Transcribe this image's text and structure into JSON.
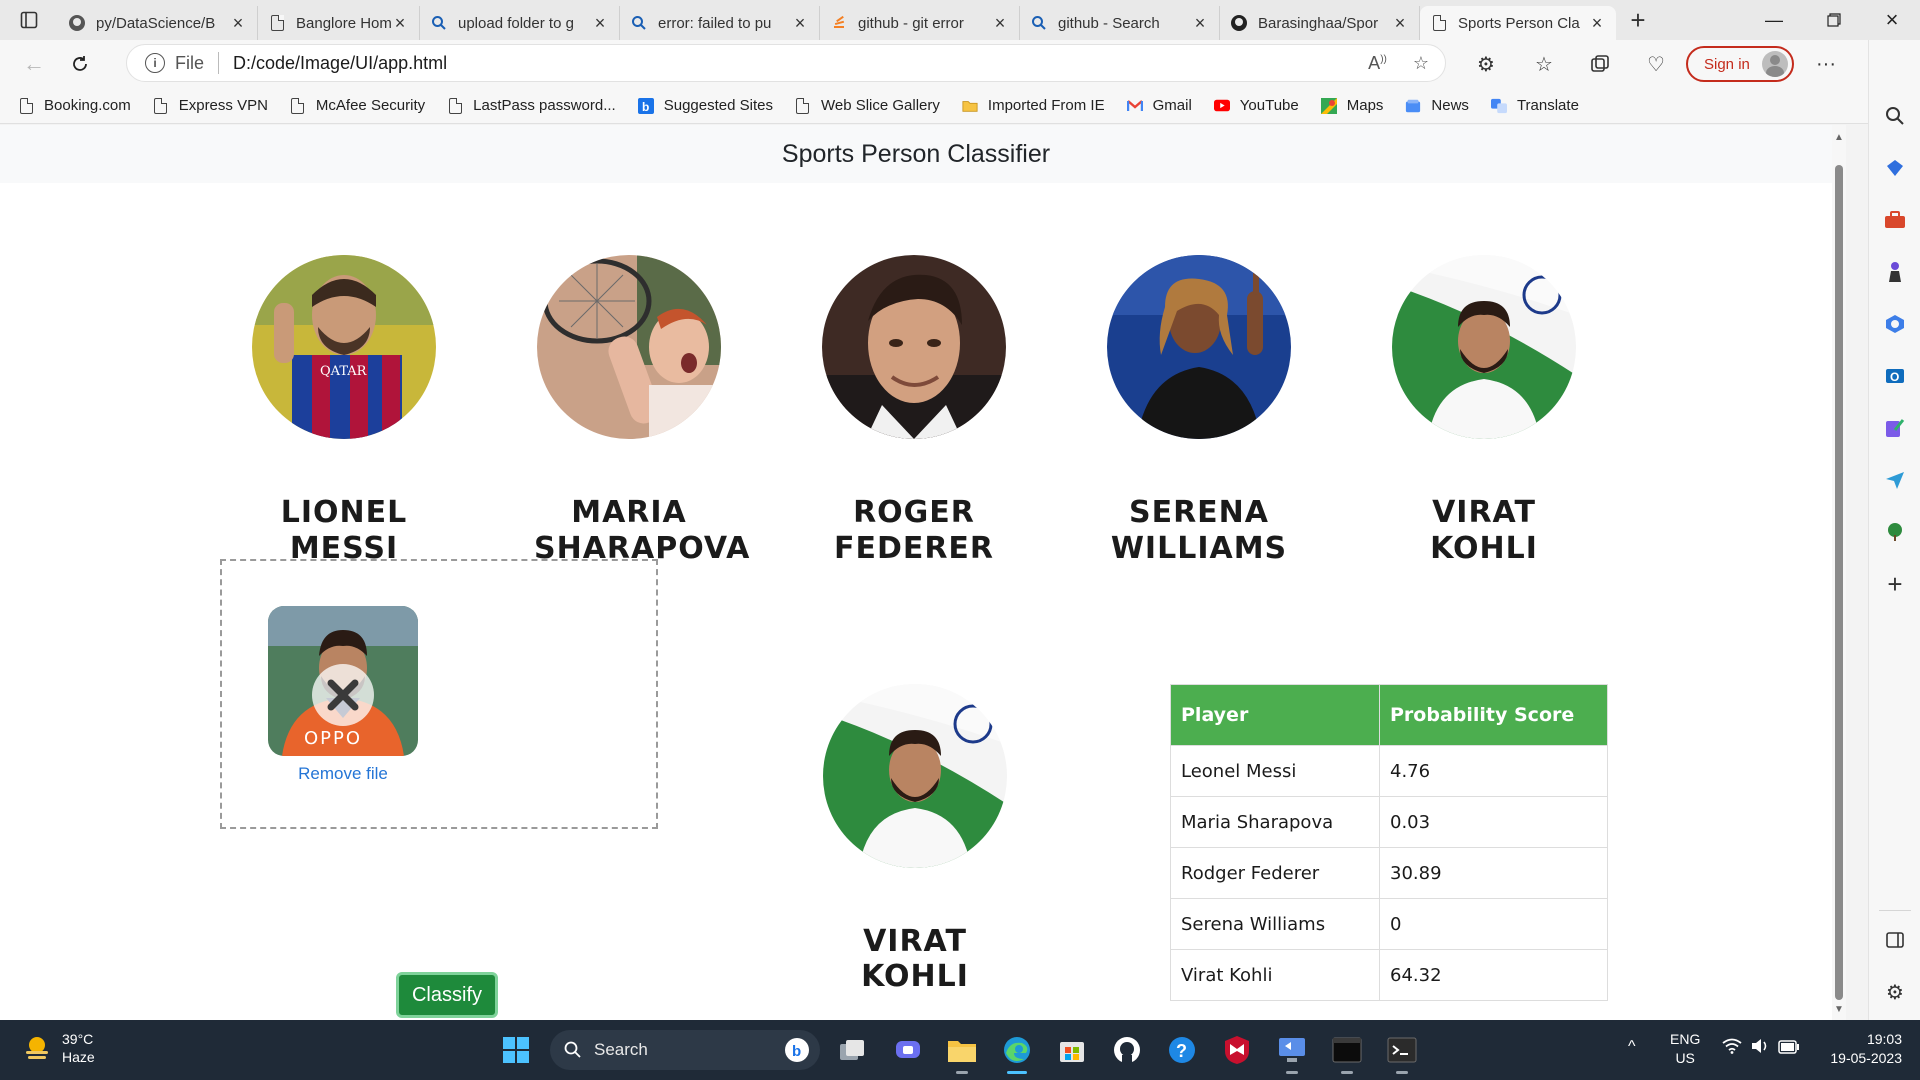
{
  "browser": {
    "tabs": [
      {
        "title": "py/DataScience/B",
        "icon": "github-icon"
      },
      {
        "title": "Banglore Home P",
        "icon": "page-icon"
      },
      {
        "title": "upload folder to g",
        "icon": "search-icon"
      },
      {
        "title": "error: failed to pu",
        "icon": "search-icon"
      },
      {
        "title": "github - git error",
        "icon": "stackoverflow-icon"
      },
      {
        "title": "github - Search",
        "icon": "search-icon"
      },
      {
        "title": "Barasinghaa/Spor",
        "icon": "github-icon"
      },
      {
        "title": "Sports Person Cla",
        "icon": "page-icon",
        "active": true
      }
    ],
    "address": {
      "scheme_label": "File",
      "url": "D:/code/Image/UI/app.html"
    },
    "sign_in_label": "Sign in",
    "bookmarks": [
      {
        "label": "Booking.com"
      },
      {
        "label": "Express VPN"
      },
      {
        "label": "McAfee Security"
      },
      {
        "label": "LastPass password..."
      },
      {
        "label": "Suggested Sites"
      },
      {
        "label": "Web Slice Gallery"
      },
      {
        "label": "Imported From IE"
      },
      {
        "label": "Gmail"
      },
      {
        "label": "YouTube"
      },
      {
        "label": "Maps"
      },
      {
        "label": "News"
      },
      {
        "label": "Translate"
      }
    ]
  },
  "page": {
    "header_title": "Sports Person Classifier",
    "players": [
      {
        "name": "LIONEL MESSI"
      },
      {
        "name": "MARIA SHARAPOVA"
      },
      {
        "name": "ROGER FEDERER"
      },
      {
        "name": "SERENA WILLIAMS"
      },
      {
        "name": "VIRAT KOHLI"
      }
    ],
    "upload": {
      "remove_label": "Remove file",
      "thumbnail_text": "OPPO"
    },
    "classify_label": "Classify",
    "result": {
      "name": "VIRAT KOHLI"
    },
    "table": {
      "headers": [
        "Player",
        "Probability Score"
      ],
      "rows": [
        {
          "player": "Leonel Messi",
          "score": "4.76"
        },
        {
          "player": "Maria Sharapova",
          "score": "0.03"
        },
        {
          "player": "Rodger Federer",
          "score": "30.89"
        },
        {
          "player": "Serena Williams",
          "score": "0"
        },
        {
          "player": "Virat Kohli",
          "score": "64.32"
        }
      ]
    },
    "colors": {
      "table_header": "#4cae4f",
      "classify_button": "#1e8a3b",
      "link": "#2475d6"
    }
  },
  "taskbar": {
    "weather": {
      "temp": "39°C",
      "condition": "Haze"
    },
    "search_label": "Search",
    "language": {
      "lang": "ENG",
      "region": "US"
    },
    "clock": {
      "time": "19:03",
      "date": "19-05-2023"
    }
  }
}
